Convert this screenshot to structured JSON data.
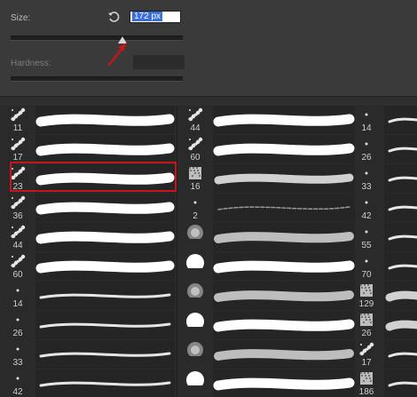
{
  "size": {
    "label": "Size:",
    "value": "172 px",
    "slider_fraction": 0.65
  },
  "hardness": {
    "label": "Hardness:",
    "slider_fraction": 1.0
  },
  "brushes": {
    "col1": [
      {
        "num": "11",
        "icon": "spatter-brush-icon",
        "stroke": "thick-brush-stroke"
      },
      {
        "num": "17",
        "icon": "spatter-brush-icon",
        "stroke": "thick-brush-stroke"
      },
      {
        "num": "23",
        "icon": "spatter-brush-icon",
        "stroke": "thick-brush-stroke",
        "selected": true
      },
      {
        "num": "36",
        "icon": "spatter-brush-icon",
        "stroke": "thick-brush-stroke"
      },
      {
        "num": "44",
        "icon": "spatter-brush-icon",
        "stroke": "thick-brush-stroke"
      },
      {
        "num": "60",
        "icon": "spatter-brush-icon",
        "stroke": "thick-brush-stroke"
      },
      {
        "num": "14",
        "icon": "small-dot-brush-icon",
        "stroke": "thin-brush-stroke"
      },
      {
        "num": "26",
        "icon": "small-dot-brush-icon",
        "stroke": "thin-brush-stroke"
      },
      {
        "num": "33",
        "icon": "small-dot-brush-icon",
        "stroke": "thin-brush-stroke"
      },
      {
        "num": "42",
        "icon": "small-dot-brush-icon",
        "stroke": "thin-brush-stroke"
      }
    ],
    "col2": [
      {
        "num": "44",
        "icon": "spatter-brush-icon",
        "stroke": "thick-brush-stroke"
      },
      {
        "num": "60",
        "icon": "spatter-brush-icon",
        "stroke": "thick-brush-stroke"
      },
      {
        "num": "16",
        "icon": "textured-brush-icon",
        "stroke": "rough-brush-stroke"
      },
      {
        "num": "2",
        "icon": "small-dot-brush-icon",
        "stroke": "faint-brush-stroke"
      },
      {
        "num": "",
        "icon": "soft-round-brush-icon",
        "stroke": "soft-brush-stroke"
      },
      {
        "num": "",
        "icon": "hard-round-brush-icon",
        "stroke": "thick-brush-stroke"
      },
      {
        "num": "",
        "icon": "soft-round-brush-icon",
        "stroke": "soft-brush-stroke"
      },
      {
        "num": "",
        "icon": "hard-round-brush-icon",
        "stroke": "thick-brush-stroke"
      },
      {
        "num": "",
        "icon": "soft-round-brush-icon",
        "stroke": "soft-brush-stroke"
      },
      {
        "num": "",
        "icon": "hard-round-brush-icon",
        "stroke": "thick-brush-stroke"
      }
    ],
    "col3": [
      {
        "num": "14",
        "icon": "small-dot-brush-icon",
        "stroke": "thin-brush-stroke"
      },
      {
        "num": "26",
        "icon": "small-dot-brush-icon",
        "stroke": "thin-brush-stroke"
      },
      {
        "num": "33",
        "icon": "small-dot-brush-icon",
        "stroke": "thin-brush-stroke"
      },
      {
        "num": "42",
        "icon": "small-dot-brush-icon",
        "stroke": "thin-brush-stroke"
      },
      {
        "num": "55",
        "icon": "small-dot-brush-icon",
        "stroke": "thin-brush-stroke"
      },
      {
        "num": "70",
        "icon": "small-dot-brush-icon",
        "stroke": "thin-brush-stroke"
      },
      {
        "num": "129",
        "icon": "textured-brush-icon",
        "stroke": "rough-brush-stroke"
      },
      {
        "num": "26",
        "icon": "textured-brush-icon",
        "stroke": "rough-brush-stroke"
      },
      {
        "num": "17",
        "icon": "spatter-brush-icon",
        "stroke": "thin-brush-stroke"
      },
      {
        "num": "186",
        "icon": "textured-brush-icon",
        "stroke": "thin-brush-stroke"
      }
    ]
  },
  "colors": {
    "selection_border": "#c4161c",
    "highlight": "#3d6fd8",
    "annotation_arrow": "#c4161c"
  }
}
